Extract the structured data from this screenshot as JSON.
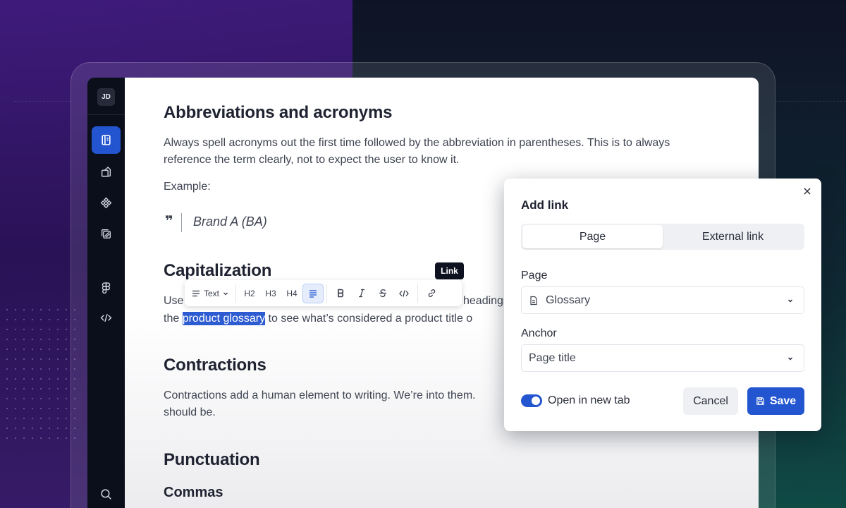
{
  "sidebar": {
    "avatar_initials": "JD",
    "items": [
      {
        "icon": "book-icon",
        "active": true
      },
      {
        "icon": "shapes-icon",
        "active": false
      },
      {
        "icon": "components-icon",
        "active": false
      },
      {
        "icon": "layers-icon",
        "active": false
      },
      {
        "icon": "figma-icon",
        "active": false
      },
      {
        "icon": "code-icon",
        "active": false
      },
      {
        "icon": "search-icon",
        "active": false
      }
    ]
  },
  "document": {
    "h_abbr": "Abbreviations and acronyms",
    "p_abbr": "Always spell acronyms out the first time followed by the abbreviation in parentheses. This is to always reference the term clearly, not to expect the user to know it.",
    "example_label": "Example:",
    "quote": "Brand A (BA)",
    "h_cap": "Capitalization",
    "p_cap_line1_start": "Use",
    "p_cap_line1_end": "headings",
    "p_cap_line2_start": "the ",
    "p_cap_link": "product glossary",
    "p_cap_line2_end": " to see what’s considered a product title o",
    "h_contr": "Contractions",
    "p_contr_line1": "Contractions add a human element to writing. We’re into them.",
    "p_contr_line2": "should be.",
    "h_punct": "Punctuation",
    "h_commas": "Commas"
  },
  "toolbar": {
    "text_style": "Text",
    "h2": "H2",
    "h3": "H3",
    "h4": "H4",
    "tooltip": "Link"
  },
  "modal": {
    "title": "Add link",
    "tabs": [
      "Page",
      "External link"
    ],
    "active_tab": "Page",
    "page_label": "Page",
    "page_value": "Glossary",
    "anchor_label": "Anchor",
    "anchor_value": "Page title",
    "open_new_tab_label": "Open in new tab",
    "open_new_tab": true,
    "cancel_label": "Cancel",
    "save_label": "Save"
  },
  "colors": {
    "accent": "#2355d0",
    "sidebar_bg": "#0b0f1c",
    "highlight": "#2d5bd1"
  }
}
